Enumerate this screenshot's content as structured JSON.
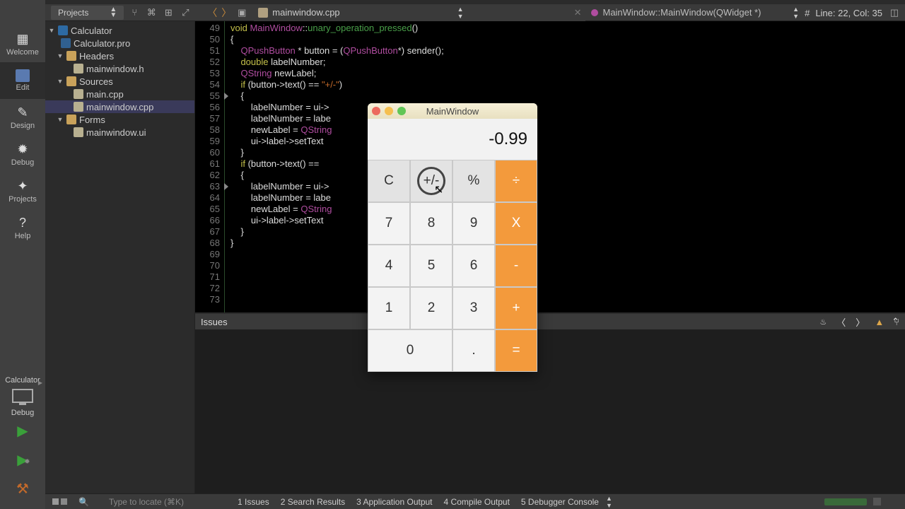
{
  "top": {
    "projects_label": "Projects",
    "file_open": "mainwindow.cpp",
    "symbol": "MainWindow::MainWindow(QWidget *)",
    "cursor_pos": "Line: 22, Col: 35"
  },
  "modes": {
    "welcome": "Welcome",
    "edit": "Edit",
    "design": "Design",
    "debug": "Debug",
    "projects": "Projects",
    "help": "Help"
  },
  "kit": {
    "name": "Calculator",
    "config": "Debug"
  },
  "tree": {
    "root": "Calculator",
    "pro": "Calculator.pro",
    "headers": "Headers",
    "header1": "mainwindow.h",
    "sources": "Sources",
    "src1": "main.cpp",
    "src2": "mainwindow.cpp",
    "forms": "Forms",
    "form1": "mainwindow.ui"
  },
  "code_start_line": 49,
  "code_lines": [
    {
      "t": "void MainWindow::unary_operation_pressed()",
      "seg": [
        [
          "kw",
          "void "
        ],
        [
          "cls",
          "MainWindow"
        ],
        [
          "",
          "::"
        ],
        [
          "fn",
          "unary_operation_pressed"
        ],
        [
          "",
          "()"
        ]
      ]
    },
    {
      "t": "{"
    },
    {
      "t": "    QPushButton * button = (QPushButton*) sender();",
      "seg": [
        [
          "",
          "    "
        ],
        [
          "cls",
          "QPushButton"
        ],
        [
          "",
          " * button = ("
        ],
        [
          "cls",
          "QPushButton"
        ],
        [
          "",
          "*) sender();"
        ]
      ]
    },
    {
      "t": "    double labelNumber;",
      "seg": [
        [
          "",
          "    "
        ],
        [
          "kw",
          "double"
        ],
        [
          "",
          " labelNumber;"
        ]
      ]
    },
    {
      "t": "    QString newLabel;",
      "seg": [
        [
          "",
          "    "
        ],
        [
          "cls",
          "QString"
        ],
        [
          "",
          " newLabel;"
        ]
      ]
    },
    {
      "t": ""
    },
    {
      "t": "    if (button->text() == \"+/-\")",
      "seg": [
        [
          "",
          "    "
        ],
        [
          "kw",
          "if"
        ],
        [
          "",
          " (button->text() == "
        ],
        [
          "str",
          "\"+/-\""
        ],
        [
          "",
          ")"
        ]
      ],
      "fold": true
    },
    {
      "t": "    {"
    },
    {
      "t": "        labelNumber = ui->"
    },
    {
      "t": "        labelNumber = labe"
    },
    {
      "t": "        newLabel = QString",
      "seg": [
        [
          "",
          "        newLabel = "
        ],
        [
          "cls",
          "QString"
        ]
      ]
    },
    {
      "t": "        ui->label->setText"
    },
    {
      "t": "    }"
    },
    {
      "t": ""
    },
    {
      "t": "    if (button->text() ==",
      "seg": [
        [
          "",
          "    "
        ],
        [
          "kw",
          "if"
        ],
        [
          "",
          " (button->text() =="
        ]
      ],
      "fold": true
    },
    {
      "t": "    {"
    },
    {
      "t": "        labelNumber = ui->"
    },
    {
      "t": "        labelNumber = labe"
    },
    {
      "t": "        newLabel = QString",
      "seg": [
        [
          "",
          "        newLabel = "
        ],
        [
          "cls",
          "QString"
        ]
      ]
    },
    {
      "t": "        ui->label->setText"
    },
    {
      "t": "    }"
    },
    {
      "t": "}"
    },
    {
      "t": ""
    },
    {
      "t": ""
    },
    {
      "t": ""
    }
  ],
  "issues_header": "Issues",
  "bottom": {
    "locate_placeholder": "Type to locate (⌘K)",
    "tabs": [
      "1  Issues",
      "2  Search Results",
      "3  Application Output",
      "4  Compile Output",
      "5  Debugger Console"
    ]
  },
  "calculator": {
    "title": "MainWindow",
    "display": "-0.99",
    "rows": [
      [
        {
          "l": "C",
          "c": "fn",
          "w": 1
        },
        {
          "l": "+/-",
          "c": "fn press",
          "w": 1
        },
        {
          "l": "%",
          "c": "fn",
          "w": 1
        },
        {
          "l": "÷",
          "c": "op",
          "w": 1
        }
      ],
      [
        {
          "l": "7",
          "c": "num",
          "w": 1
        },
        {
          "l": "8",
          "c": "num",
          "w": 1
        },
        {
          "l": "9",
          "c": "num",
          "w": 1
        },
        {
          "l": "X",
          "c": "op",
          "w": 1
        }
      ],
      [
        {
          "l": "4",
          "c": "num",
          "w": 1
        },
        {
          "l": "5",
          "c": "num",
          "w": 1
        },
        {
          "l": "6",
          "c": "num",
          "w": 1
        },
        {
          "l": "-",
          "c": "op",
          "w": 1
        }
      ],
      [
        {
          "l": "1",
          "c": "num",
          "w": 1
        },
        {
          "l": "2",
          "c": "num",
          "w": 1
        },
        {
          "l": "3",
          "c": "num",
          "w": 1
        },
        {
          "l": "+",
          "c": "op",
          "w": 1
        }
      ],
      [
        {
          "l": "0",
          "c": "num",
          "w": 2
        },
        {
          "l": ".",
          "c": "num",
          "w": 1
        },
        {
          "l": "=",
          "c": "op",
          "w": 1
        }
      ]
    ]
  }
}
